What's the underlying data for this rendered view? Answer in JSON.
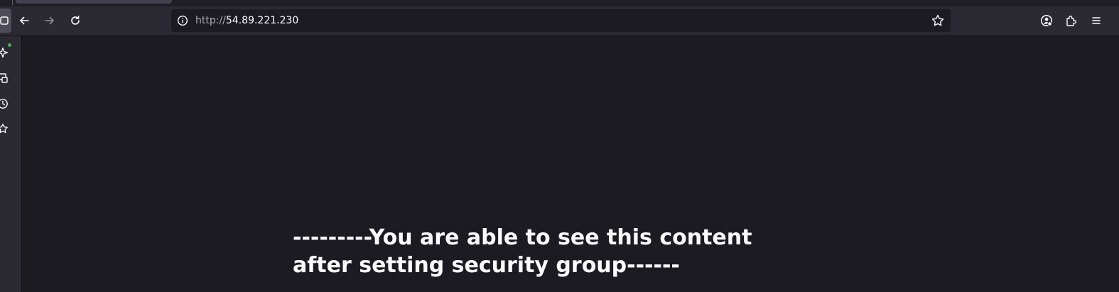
{
  "browser": {
    "url": {
      "scheme": "http://",
      "host": "54.89.221.230"
    },
    "toolbar_icons": {
      "back": "arrow-left-icon",
      "forward": "arrow-right-icon",
      "reload": "reload-icon",
      "site_info": "info-icon",
      "bookmark": "star-icon",
      "account": "account-icon",
      "extensions": "puzzle-icon",
      "menu": "hamburger-menu-icon"
    },
    "sidebar_icons": [
      "sparkle-icon",
      "synced-tabs-icon",
      "history-icon",
      "bookmarks-icon"
    ],
    "colors": {
      "toolbar_bg": "#2b2a33",
      "content_bg": "#1c1b22",
      "text": "#fbfbfe",
      "notification_dot": "#3fb950"
    }
  },
  "page": {
    "message": "---------You are able to see this content after setting security group------"
  }
}
